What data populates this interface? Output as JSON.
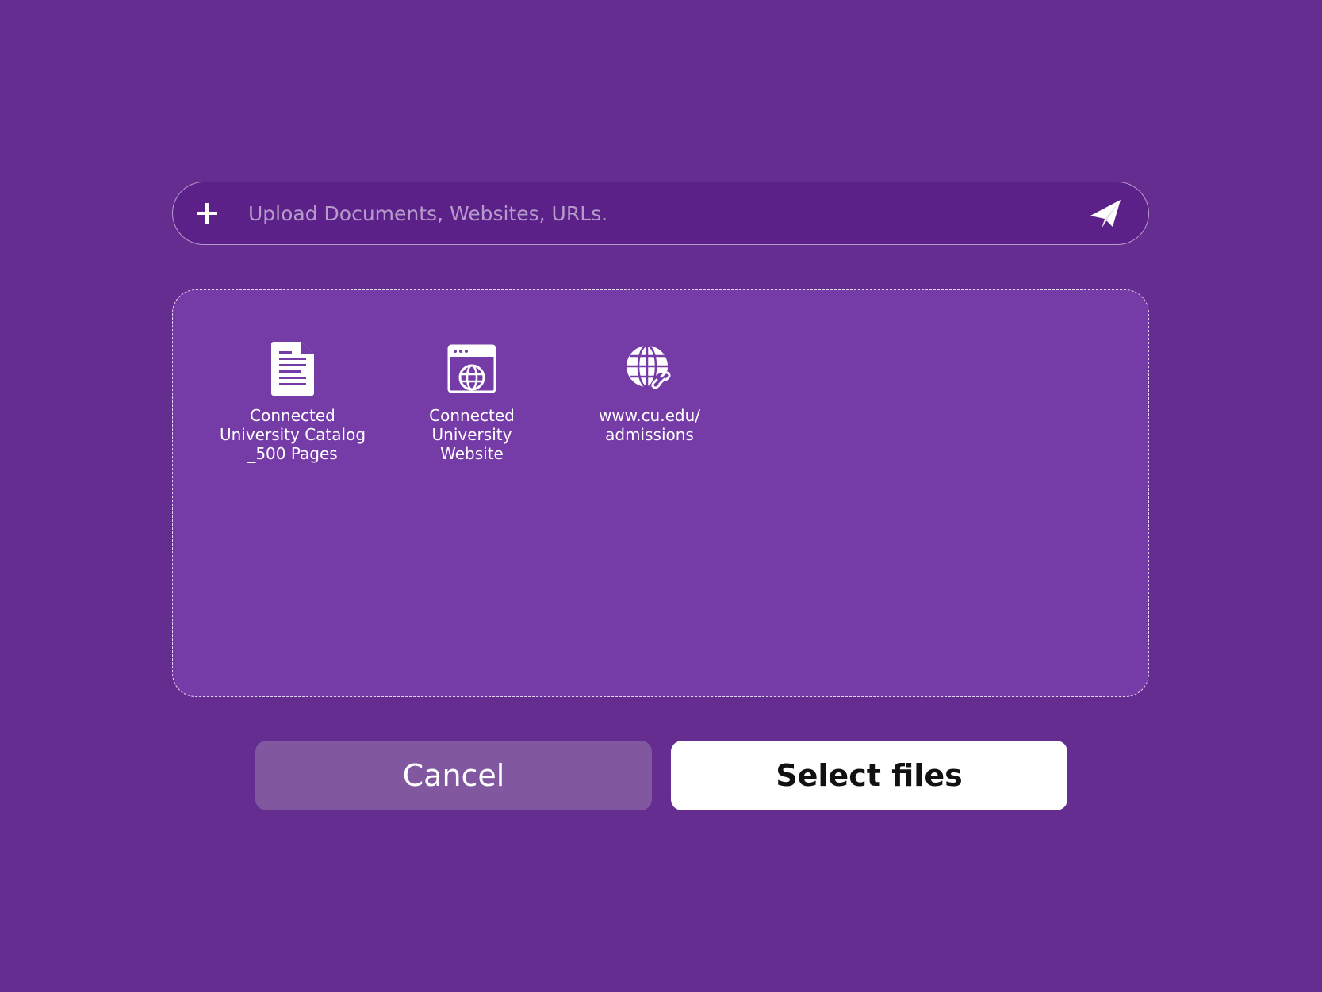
{
  "upload_bar": {
    "placeholder": "Upload Documents, Websites, URLs.",
    "add_icon": "plus-icon",
    "send_icon": "paper-plane-icon"
  },
  "sources": [
    {
      "label": "Connected\nUniversity Catalog\n_500 Pages",
      "icon": "document-icon"
    },
    {
      "label": "Connected\nUniversity\nWebsite",
      "icon": "website-icon"
    },
    {
      "label": "www.cu.edu/\nadmissions",
      "icon": "globe-link-icon"
    }
  ],
  "actions": {
    "cancel_label": "Cancel",
    "select_label": "Select files"
  },
  "colors": {
    "background": "#652d90",
    "input_bg": "#5b2189",
    "drop_zone_bg": "#753ba7",
    "cancel_bg": "#8158a0",
    "select_bg": "#ffffff"
  }
}
